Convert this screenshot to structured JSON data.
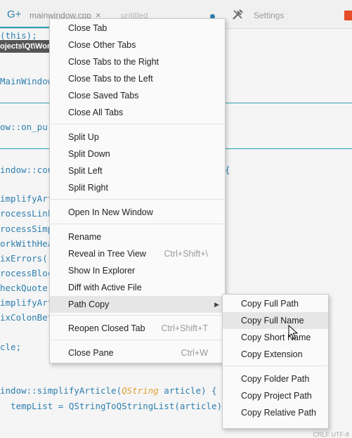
{
  "tabbar": {
    "g_icon": "G+",
    "file_tab": "mainwindow.cpp",
    "close_glyph": "×",
    "untitled_tab": "untitled",
    "settings_tab": "Settings"
  },
  "editor": {
    "path_badge": "ojects\\Qt\\Word",
    "lines": [
      "(this);",
      "MainWindow",
      "ow::on_pu",
      "indow::cou",
      "{",
      "implifyArt",
      "rocessLink",
      "rocessSimp",
      "orkWithHea",
      "ixErrors(",
      "rocessBloc",
      "heckQuote",
      "implifyArt",
      "ixColonBet",
      "cle;",
      "indow::simplifyArticle(",
      "QString",
      " article) {",
      "  tempList = QStringToQStringList(article)"
    ],
    "status_text": "CRLF   UTF-8"
  },
  "main_menu": {
    "items": [
      {
        "label": "Close Tab"
      },
      {
        "label": "Close Other Tabs"
      },
      {
        "label": "Close Tabs to the Right"
      },
      {
        "label": "Close Tabs to the Left"
      },
      {
        "label": "Close Saved Tabs"
      },
      {
        "label": "Close All Tabs"
      },
      {
        "label": "Split Up"
      },
      {
        "label": "Split Down"
      },
      {
        "label": "Split Left"
      },
      {
        "label": "Split Right"
      },
      {
        "label": "Open In New Window"
      },
      {
        "label": "Rename"
      },
      {
        "label": "Reveal in Tree View",
        "shortcut": "Ctrl+Shift+\\"
      },
      {
        "label": "Show In Explorer"
      },
      {
        "label": "Diff with Active File"
      },
      {
        "label": "Path Copy",
        "submenu_arrow": "▶"
      },
      {
        "label": "Reopen Closed Tab",
        "shortcut": "Ctrl+Shift+T"
      },
      {
        "label": "Close Pane",
        "shortcut": "Ctrl+W"
      }
    ]
  },
  "sub_menu": {
    "items": [
      {
        "label": "Copy Full Path"
      },
      {
        "label": "Copy Full Name"
      },
      {
        "label": "Copy Short Name"
      },
      {
        "label": "Copy Extension"
      },
      {
        "label": "Copy Folder Path"
      },
      {
        "label": "Copy Project Path"
      },
      {
        "label": "Copy Relative Path"
      }
    ]
  },
  "colors": {
    "accent": "#2aa0b0",
    "code_blue": "#2d7fb0",
    "keyword_orange": "#e0a030",
    "menu_hover": "#e6e6e6"
  },
  "icons": [
    "g-plus-icon",
    "close-icon",
    "modified-dot-icon",
    "tools-icon",
    "html5-icon",
    "submenu-arrow-icon",
    "mouse-cursor-icon"
  ]
}
